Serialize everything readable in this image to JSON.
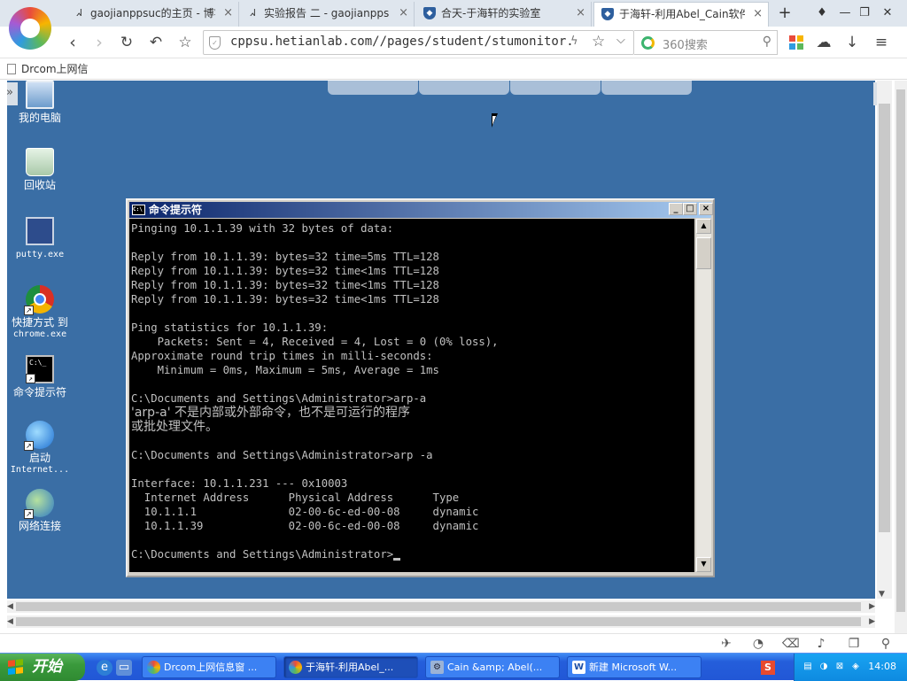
{
  "browser": {
    "tabs": [
      {
        "label": "gaojianppsuc的主页 - 博客",
        "favicon": "page-icon"
      },
      {
        "label": "实验报告 二 - gaojianpps",
        "favicon": "page-icon"
      },
      {
        "label": "合天-于海轩的实验室",
        "favicon": "shield-icon"
      },
      {
        "label": "于海轩-利用Abel_Cain软件",
        "favicon": "shield-icon"
      }
    ],
    "active_tab": 3,
    "new_tab": "+",
    "url": "cppsu.hetianlab.com//pages/student/stumonitor.js",
    "search_placeholder": "360搜索",
    "bookmark": "Drcom上网信"
  },
  "desktop": {
    "icons": [
      {
        "label": "我的电脑",
        "sub": ""
      },
      {
        "label": "回收站",
        "sub": ""
      },
      {
        "label": "putty.exe",
        "sub": ""
      },
      {
        "label": "快捷方式 到",
        "sub": "chrome.exe"
      },
      {
        "label": "命令提示符",
        "sub": ""
      },
      {
        "label": "启动",
        "sub": "Internet..."
      },
      {
        "label": "网络连接",
        "sub": ""
      }
    ]
  },
  "cmd": {
    "title": "命令提示符",
    "lines": [
      "Pinging 10.1.1.39 with 32 bytes of data:",
      "",
      "Reply from 10.1.1.39: bytes=32 time=5ms TTL=128",
      "Reply from 10.1.1.39: bytes=32 time<1ms TTL=128",
      "Reply from 10.1.1.39: bytes=32 time<1ms TTL=128",
      "Reply from 10.1.1.39: bytes=32 time<1ms TTL=128",
      "",
      "Ping statistics for 10.1.1.39:",
      "    Packets: Sent = 4, Received = 4, Lost = 0 (0% loss),",
      "Approximate round trip times in milli-seconds:",
      "    Minimum = 0ms, Maximum = 5ms, Average = 1ms",
      "",
      "C:\\Documents and Settings\\Administrator>arp-a",
      "'arp-a' 不是内部或外部命令，也不是可运行的程序",
      "或批处理文件。",
      "",
      "C:\\Documents and Settings\\Administrator>arp -a",
      "",
      "Interface: 10.1.1.231 --- 0x10003",
      "  Internet Address      Physical Address      Type",
      "  10.1.1.1              02-00-6c-ed-00-08     dynamic",
      "  10.1.1.39             02-00-6c-ed-00-08     dynamic",
      "",
      "C:\\Documents and Settings\\Administrator>"
    ]
  },
  "taskbar": {
    "start": "开始",
    "tasks": [
      {
        "label": "Drcom上网信息窗 ...",
        "icon": "browser-360-icon"
      },
      {
        "label": "于海轩-利用Abel_...",
        "icon": "browser-360-icon"
      },
      {
        "label": "Cain &amp; Abel(...",
        "icon": "cain-icon"
      },
      {
        "label": "新建 Microsoft W...",
        "icon": "word-icon"
      }
    ],
    "active_task": 1,
    "clock": "14:08"
  },
  "colors": {
    "desktop": "#3a6ea5",
    "taskbar": "#245edb",
    "cmd_background": "#000000",
    "cmd_text": "#c0c0c0"
  }
}
